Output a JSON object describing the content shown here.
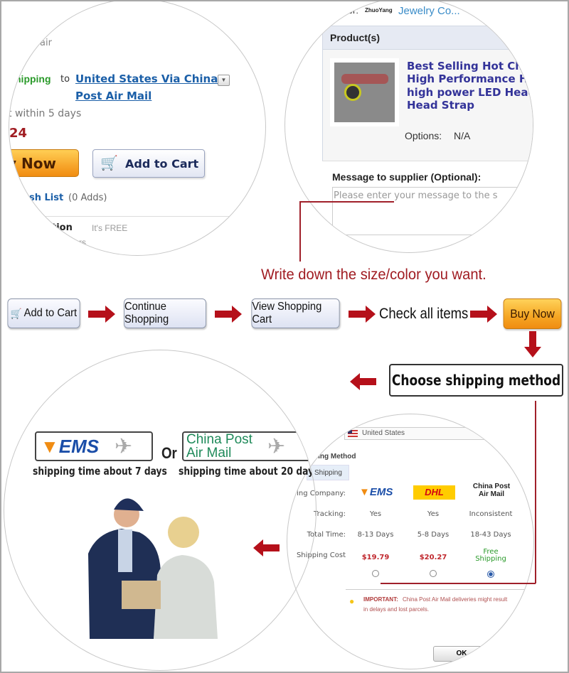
{
  "top_left": {
    "air_fragment": "air",
    "shipping_fragment": "hipping",
    "to": "to",
    "shipping_link_line1": "United States Via China",
    "shipping_link_line2": "Post Air Mail",
    "delivery": "t within 5 days",
    "price_fragment": "24",
    "buy_now_fragment": "y Now",
    "add_to_cart": "Add to Cart",
    "wish_list": "sh List",
    "wish_count": "(0 Adds)",
    "protection": "tion",
    "protection_note": "It's FREE",
    "rs_fragment": "rs"
  },
  "top_right": {
    "supplier_label": "lier:",
    "supplier_small": "ZhuoYang",
    "supplier_name": "Jewelry Co...",
    "products_header": "Product(s)",
    "product_title": [
      "Best Selling Hot Chi",
      "High Performance He",
      "high power LED Head",
      "Head Strap"
    ],
    "options_label": "Options:",
    "options_value": "N/A",
    "message_label": "Message to supplier (Optional):",
    "message_placeholder": "Please enter your message to the s"
  },
  "annotation": "Write down the size/color you want.",
  "flow": {
    "add_to_cart": "Add to Cart",
    "continue_shopping": "Continue Shopping",
    "view_cart": "View Shopping Cart",
    "check_items": "Check all items",
    "buy_now": "Buy Now",
    "choose_shipping": "Choose shipping method"
  },
  "bottom_left": {
    "ems_logo": "EMS",
    "or": "Or",
    "china_post_line1": "China Post",
    "china_post_line2": "Air Mail",
    "ems_time": "shipping time about 7 days",
    "china_post_time": "shipping time about 20 days"
  },
  "bottom_right": {
    "country": "United States",
    "section_title": "ping Method",
    "tab": "Shipping",
    "row_labels": [
      "pping Company:",
      "Tracking:",
      "Total Time:",
      "Shipping Cost"
    ],
    "companies": [
      {
        "name": "EMS",
        "tracking": "Yes",
        "time": "8-13 Days",
        "cost": "$19.79",
        "selected": false
      },
      {
        "name": "DHL",
        "tracking": "Yes",
        "time": "5-8 Days",
        "cost": "$20.27",
        "selected": false
      },
      {
        "name": "China Post Air Mail",
        "tracking": "Inconsistent",
        "time": "18-43 Days",
        "cost": "Free Shipping",
        "selected": true
      }
    ],
    "important_label": "IMPORTANT:",
    "important_text_1": "China Post Air Mail deliveries might result",
    "important_text_2": "in delays and lost parcels.",
    "ok": "OK"
  },
  "colors": {
    "accent_red": "#a01c22",
    "arrow_red": "#b5101a",
    "link_blue": "#1b5fa8",
    "product_blue": "#333399",
    "free_green": "#2a9a2a"
  }
}
